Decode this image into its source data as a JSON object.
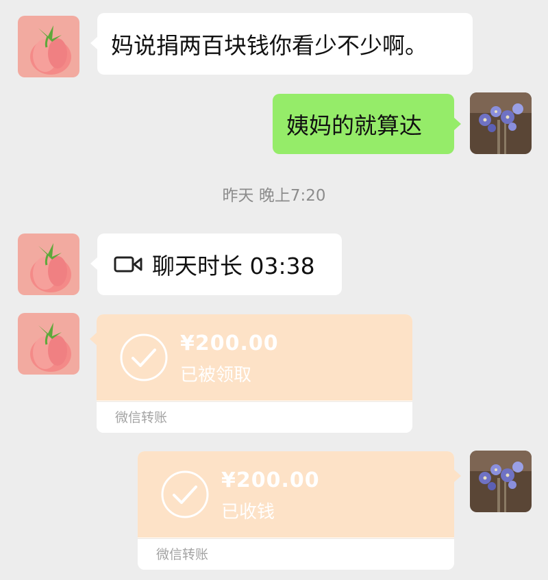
{
  "messages": [
    {
      "text": "妈说捐两百块钱你看少不少啊。"
    },
    {
      "text": "姨妈的就算达"
    }
  ],
  "timestamp": "昨天 晚上7:20",
  "call": {
    "text": "聊天时长 03:38"
  },
  "transfers": [
    {
      "amount": "¥200.00",
      "status": "已被领取",
      "footer": "微信转账"
    },
    {
      "amount": "¥200.00",
      "status": "已收钱",
      "footer": "微信转账"
    }
  ],
  "colors": {
    "background": "#ededed",
    "sent_bubble": "#95ec69",
    "received_bubble": "#ffffff",
    "transfer_card": "#fde2c7"
  }
}
